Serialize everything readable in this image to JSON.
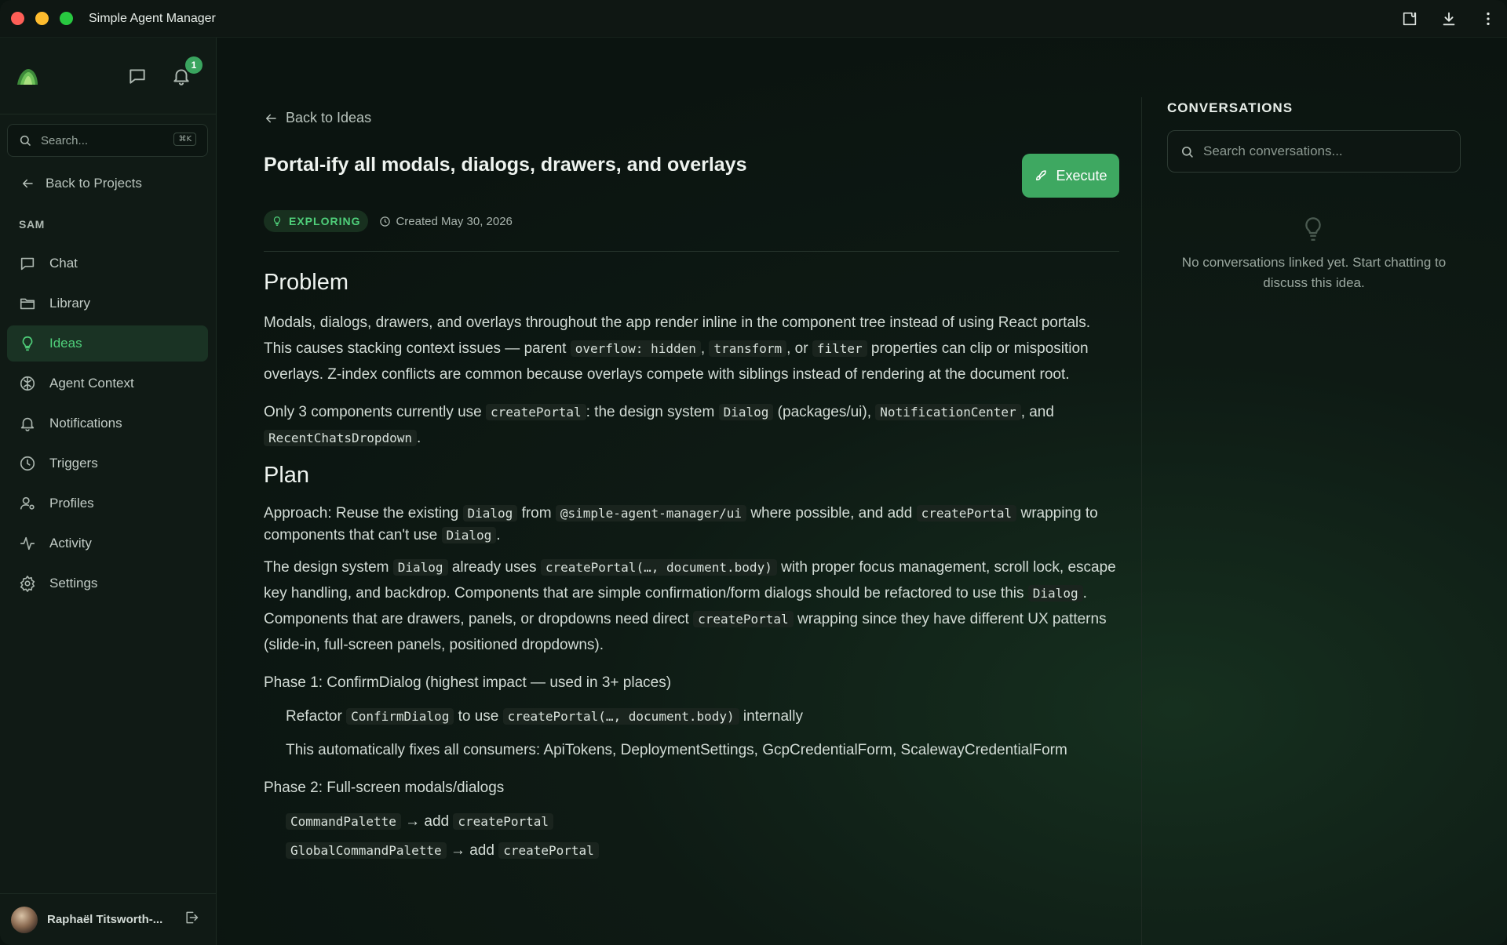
{
  "window": {
    "title": "Simple Agent Manager"
  },
  "sidebar": {
    "notification_count": "1",
    "search": {
      "placeholder": "Search...",
      "shortcut": "⌘K"
    },
    "back_label": "Back to Projects",
    "section": "SAM",
    "items": [
      {
        "label": "Chat",
        "icon": "chat-icon"
      },
      {
        "label": "Library",
        "icon": "folder-icon"
      },
      {
        "label": "Ideas",
        "icon": "lightbulb-icon",
        "active": true
      },
      {
        "label": "Agent Context",
        "icon": "brain-icon"
      },
      {
        "label": "Notifications",
        "icon": "bell-icon"
      },
      {
        "label": "Triggers",
        "icon": "clock-icon"
      },
      {
        "label": "Profiles",
        "icon": "user-gear-icon"
      },
      {
        "label": "Activity",
        "icon": "activity-icon"
      },
      {
        "label": "Settings",
        "icon": "gear-icon"
      }
    ],
    "user": {
      "name": "Raphaël Titsworth-..."
    }
  },
  "main": {
    "back_label": "Back to Ideas",
    "title": "Portal-ify all modals, dialogs, drawers, and overlays",
    "execute_label": "Execute",
    "status": "EXPLORING",
    "created": "Created May 30, 2026",
    "problem": {
      "heading": "Problem",
      "p1_a": "Modals, dialogs, drawers, and overlays throughout the app render inline in the component tree instead of using React portals. This causes stacking context issues — parent ",
      "p1_code1": "overflow: hidden",
      "p1_b": ", ",
      "p1_code2": "transform",
      "p1_c": ", or ",
      "p1_code3": "filter",
      "p1_d": " properties can clip or misposition overlays. Z-index conflicts are common because overlays compete with siblings instead of rendering at the document root.",
      "p2_a": "Only 3 components currently use ",
      "p2_code1": "createPortal",
      "p2_b": ": the design system ",
      "p2_code2": "Dialog",
      "p2_c": " (packages/ui), ",
      "p2_code3": "NotificationCenter",
      "p2_d": ", and ",
      "p2_code4": "RecentChatsDropdown",
      "p2_e": "."
    },
    "plan": {
      "heading": "Plan",
      "p1_a": "Approach: Reuse the existing ",
      "p1_code1": "Dialog",
      "p1_b": " from ",
      "p1_code2": "@simple-agent-manager/ui",
      "p1_c": " where possible, and add ",
      "p1_code3": "createPortal",
      "p1_d": " wrapping to components that can't use ",
      "p1_code4": "Dialog",
      "p1_e": ".",
      "p2_a": "The design system ",
      "p2_code1": "Dialog",
      "p2_b": " already uses ",
      "p2_code2": "createPortal(…, document.body)",
      "p2_c": " with proper focus management, scroll lock, escape key handling, and backdrop. Components that are simple confirmation/form dialogs should be refactored to use this ",
      "p2_code3": "Dialog",
      "p2_d": ". Components that are drawers, panels, or dropdowns need direct ",
      "p2_code4": "createPortal",
      "p2_e": " wrapping since they have different UX patterns (slide-in, full-screen panels, positioned dropdowns).",
      "phase1": "Phase 1: ConfirmDialog (highest impact — used in 3+ places)",
      "phase1_a": "Refactor ",
      "phase1_code1": "ConfirmDialog",
      "phase1_b": " to use ",
      "phase1_code2": "createPortal(…, document.body)",
      "phase1_c": " internally",
      "phase1_d": "This automatically fixes all consumers: ApiTokens, DeploymentSettings, GcpCredentialForm, ScalewayCredentialForm",
      "phase2": "Phase 2: Full-screen modals/dialogs",
      "phase2_code1": "CommandPalette",
      "phase2_arrow": " → add ",
      "phase2_code2": "createPortal",
      "phase2_code3": "GlobalCommandPalette",
      "phase2_code4": "createPortal"
    }
  },
  "conversations": {
    "title": "CONVERSATIONS",
    "search_placeholder": "Search conversations...",
    "empty": "No conversations linked yet. Start chatting to discuss this idea."
  },
  "colors": {
    "accent": "#3ea861",
    "active_text": "#4fcf7a",
    "background": "#0b1410"
  }
}
